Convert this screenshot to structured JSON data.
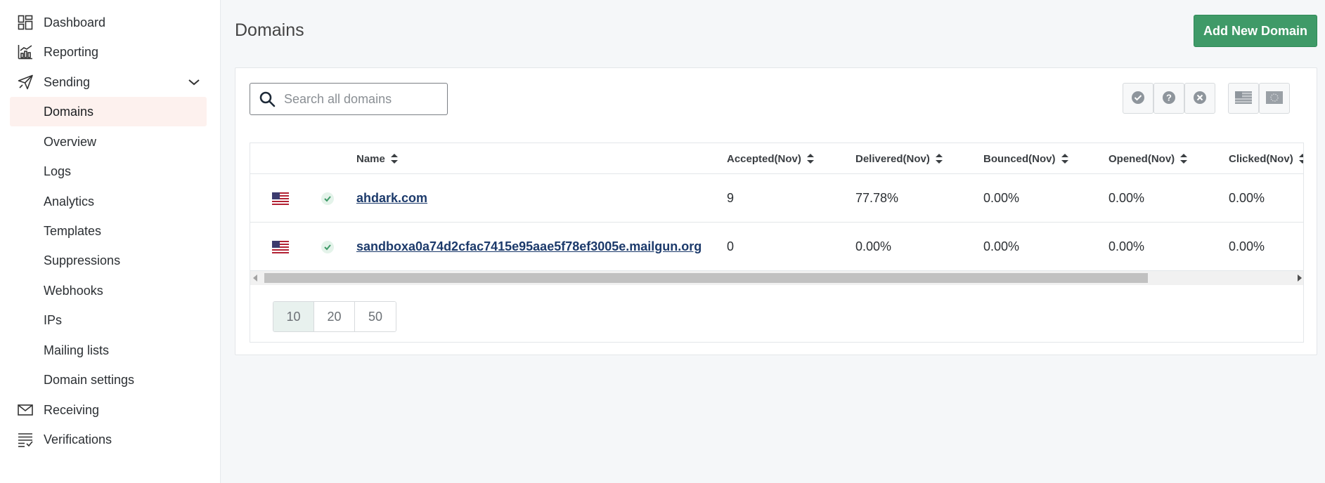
{
  "sidebar": {
    "items": [
      {
        "label": "Dashboard",
        "icon": "dashboard-icon"
      },
      {
        "label": "Reporting",
        "icon": "chart-icon"
      },
      {
        "label": "Sending",
        "icon": "paper-plane-icon"
      },
      {
        "label": "Receiving",
        "icon": "envelope-icon"
      },
      {
        "label": "Verifications",
        "icon": "checklist-icon"
      }
    ],
    "sending_sub": [
      {
        "label": "Domains"
      },
      {
        "label": "Overview"
      },
      {
        "label": "Logs"
      },
      {
        "label": "Analytics"
      },
      {
        "label": "Templates"
      },
      {
        "label": "Suppressions"
      },
      {
        "label": "Webhooks"
      },
      {
        "label": "IPs"
      },
      {
        "label": "Mailing lists"
      },
      {
        "label": "Domain settings"
      }
    ]
  },
  "header": {
    "title": "Domains",
    "add_button": "Add New Domain"
  },
  "search": {
    "placeholder": "Search all domains"
  },
  "table": {
    "columns": [
      "Name",
      "Accepted(Nov)",
      "Delivered(Nov)",
      "Bounced(Nov)",
      "Opened(Nov)",
      "Clicked(Nov)"
    ],
    "rows": [
      {
        "name": "ahdark.com",
        "accepted": "9",
        "delivered": "77.78%",
        "bounced": "0.00%",
        "opened": "0.00%",
        "clicked": "0.00%"
      },
      {
        "name": "sandboxa0a74d2cfac7415e95aae5f78ef3005e.mailgun.org",
        "accepted": "0",
        "delivered": "0.00%",
        "bounced": "0.00%",
        "opened": "0.00%",
        "clicked": "0.00%"
      }
    ]
  },
  "pagination": {
    "sizes": [
      "10",
      "20",
      "50"
    ],
    "selected": "10"
  },
  "colors": {
    "accent": "#3f9a68",
    "link": "#1c3a6b",
    "active_nav_bg": "#fdf1ee"
  }
}
